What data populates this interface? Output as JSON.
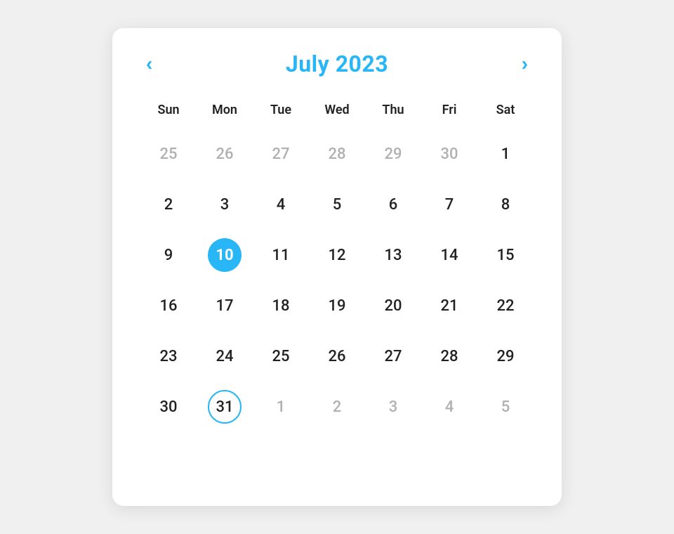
{
  "calendar": {
    "title": "July 2023",
    "prev_label": "‹",
    "next_label": "›",
    "weekdays": [
      "Sun",
      "Mon",
      "Tue",
      "Wed",
      "Thu",
      "Fri",
      "Sat"
    ],
    "weeks": [
      [
        {
          "day": "25",
          "outside": true
        },
        {
          "day": "26",
          "outside": true
        },
        {
          "day": "27",
          "outside": true
        },
        {
          "day": "28",
          "outside": true
        },
        {
          "day": "29",
          "outside": true
        },
        {
          "day": "30",
          "outside": true
        },
        {
          "day": "1",
          "outside": false
        }
      ],
      [
        {
          "day": "2",
          "outside": false
        },
        {
          "day": "3",
          "outside": false
        },
        {
          "day": "4",
          "outside": false
        },
        {
          "day": "5",
          "outside": false
        },
        {
          "day": "6",
          "outside": false
        },
        {
          "day": "7",
          "outside": false
        },
        {
          "day": "8",
          "outside": false
        }
      ],
      [
        {
          "day": "9",
          "outside": false
        },
        {
          "day": "10",
          "outside": false,
          "selected": true
        },
        {
          "day": "11",
          "outside": false
        },
        {
          "day": "12",
          "outside": false
        },
        {
          "day": "13",
          "outside": false
        },
        {
          "day": "14",
          "outside": false
        },
        {
          "day": "15",
          "outside": false
        }
      ],
      [
        {
          "day": "16",
          "outside": false
        },
        {
          "day": "17",
          "outside": false
        },
        {
          "day": "18",
          "outside": false
        },
        {
          "day": "19",
          "outside": false
        },
        {
          "day": "20",
          "outside": false
        },
        {
          "day": "21",
          "outside": false
        },
        {
          "day": "22",
          "outside": false
        }
      ],
      [
        {
          "day": "23",
          "outside": false
        },
        {
          "day": "24",
          "outside": false
        },
        {
          "day": "25",
          "outside": false
        },
        {
          "day": "26",
          "outside": false
        },
        {
          "day": "27",
          "outside": false
        },
        {
          "day": "28",
          "outside": false
        },
        {
          "day": "29",
          "outside": false
        }
      ],
      [
        {
          "day": "30",
          "outside": false
        },
        {
          "day": "31",
          "outside": false,
          "today_outline": true
        },
        {
          "day": "1",
          "outside": true
        },
        {
          "day": "2",
          "outside": true
        },
        {
          "day": "3",
          "outside": true
        },
        {
          "day": "4",
          "outside": true
        },
        {
          "day": "5",
          "outside": true
        }
      ]
    ]
  }
}
